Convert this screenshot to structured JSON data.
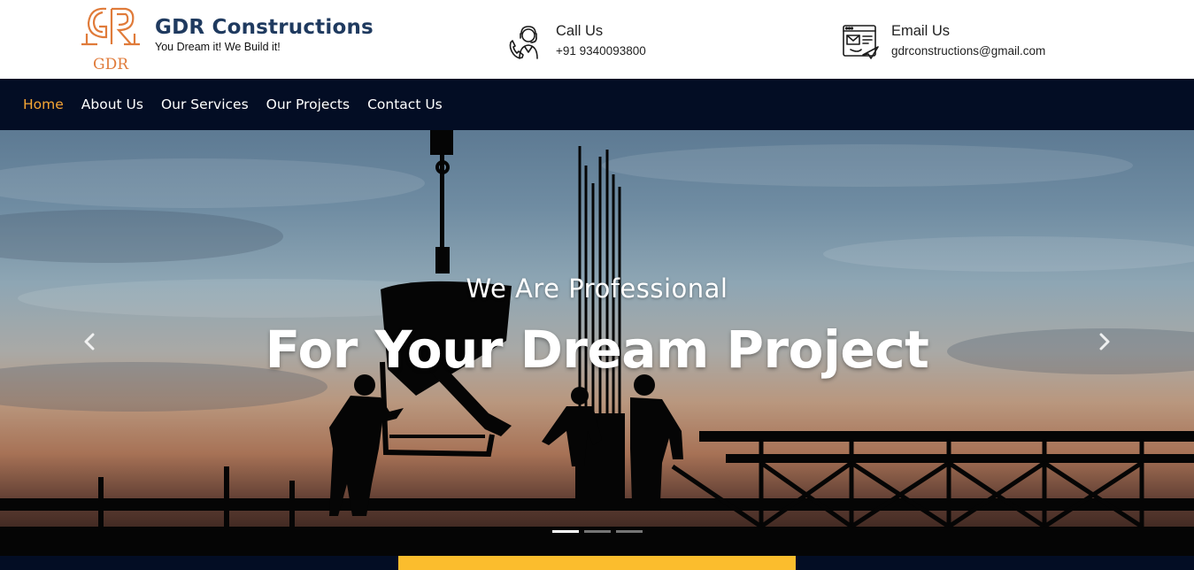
{
  "brand": {
    "logo_monogram": "GR",
    "logo_text": "GDR",
    "title": "GDR Constructions",
    "tagline": "You Dream it! We Build it!"
  },
  "contacts": {
    "call": {
      "label": "Call Us",
      "value": "+91 9340093800",
      "icon": "support-agent-phone-icon"
    },
    "email": {
      "label": "Email Us",
      "value": "gdrconstructions@gmail.com",
      "icon": "email-window-icon"
    }
  },
  "nav": {
    "items": [
      {
        "label": "Home",
        "active": true
      },
      {
        "label": "About Us",
        "active": false
      },
      {
        "label": "Our Services",
        "active": false
      },
      {
        "label": "Our Projects",
        "active": false
      },
      {
        "label": "Contact Us",
        "active": false
      }
    ]
  },
  "hero": {
    "subtitle": "We Are Professional",
    "title": "For Your Dream Project",
    "slides": 3,
    "active_slide": 1
  },
  "colors": {
    "brand_text": "#1f3a5f",
    "logo_orange": "#e07b3a",
    "nav_bg": "#030d24",
    "nav_active": "#f7a634",
    "accent_bar": "#fbbd2d"
  }
}
